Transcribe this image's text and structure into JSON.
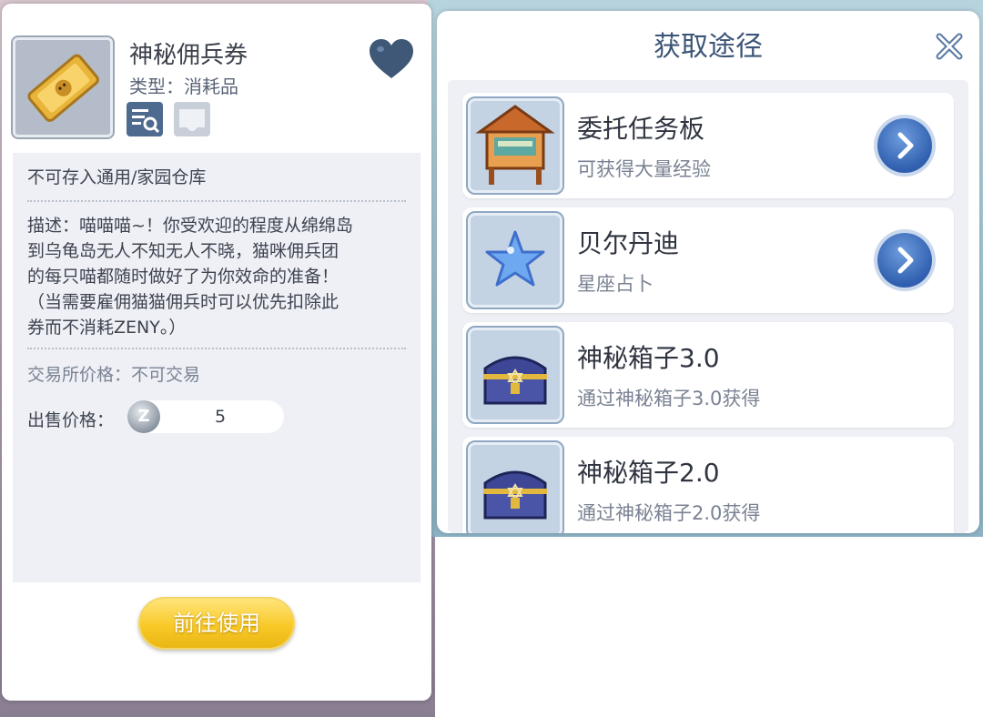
{
  "item": {
    "name": "神秘佣兵券",
    "type_label": "类型：消耗品",
    "storage_note": "不可存入通用/家园仓库",
    "description_lines": [
      "描述：喵喵喵~！你受欢迎的程度从绵绵岛",
      "到乌龟岛无人不知无人不晓，猫咪佣兵团",
      "的每只喵都随时做好了为你效命的准备！",
      "（当需要雇佣猫猫佣兵时可以优先扣除此",
      "券而不消耗ZENY。）"
    ],
    "trade_label": "交易所价格：不可交易",
    "sell_label": "出售价格：",
    "zeny_symbol": "Z",
    "sell_price": "5",
    "use_button": "前往使用"
  },
  "sources": {
    "title": "获取途径",
    "items": [
      {
        "name": "委托任务板",
        "desc": "可获得大量经验",
        "has_go": true,
        "icon": "bulletin-board-icon"
      },
      {
        "name": "贝尔丹迪",
        "desc": "星座占卜",
        "has_go": true,
        "icon": "star-icon"
      },
      {
        "name": "神秘箱子3.0",
        "desc": "通过神秘箱子3.0获得",
        "has_go": false,
        "icon": "treasure-chest-icon"
      },
      {
        "name": "神秘箱子2.0",
        "desc": "通过神秘箱子2.0获得",
        "has_go": false,
        "icon": "treasure-chest-icon"
      }
    ]
  },
  "colors": {
    "accent_blue": "#3d5577",
    "gold_button": "#f8c928",
    "panel_bg": "#eef0f5"
  }
}
